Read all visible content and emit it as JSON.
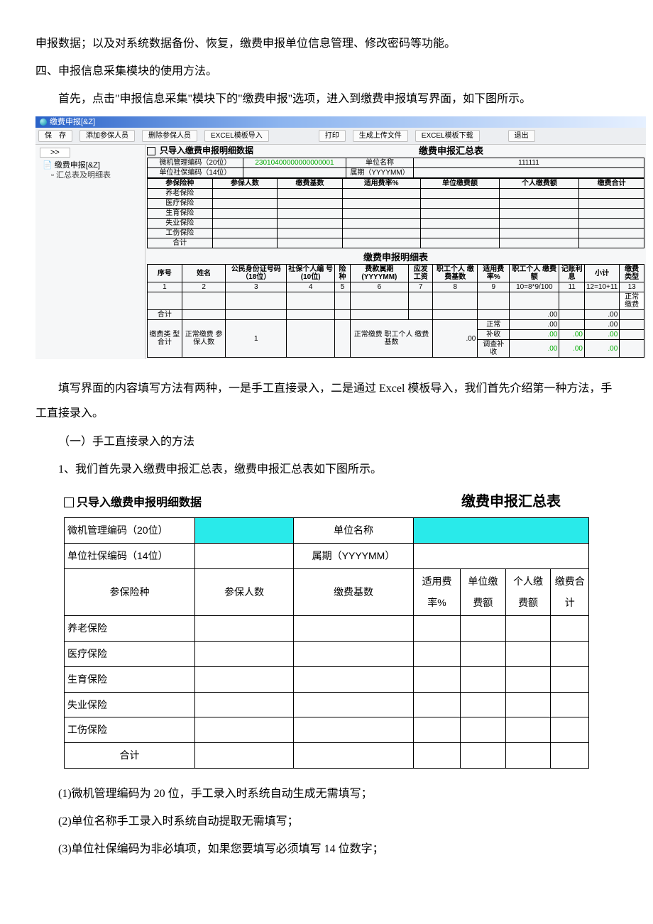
{
  "p": {
    "p1": "申报数据；以及对系统数据备份、恢复，缴费申报单位信息管理、修改密码等功能。",
    "p2": "四、申报信息采集模块的使用方法。",
    "p3": "首先，点击\"申报信息采集\"模块下的\"缴费申报\"选项，进入到缴费申报填写界面，如下图所示。",
    "p4": "填写界面的内容填写方法有两种，一是手工直接录入，二是通过 Excel 模板导入，我们首先介绍第一种方法，手工直接录入。",
    "p5": "（一）手工直接录入的方法",
    "p6": "1、我们首先录入缴费申报汇总表，缴费申报汇总表如下图所示。",
    "p7": "(1)微机管理编码为 20 位，手工录入时系统自动生成无需填写；",
    "p8": "(2)单位名称手工录入时系统自动提取无需填写；",
    "p9": "(3)单位社保编码为非必填项，如果您要填写必须填写 14 位数字；"
  },
  "s1": {
    "titlebar": "缴费申报[&Z]",
    "toolbar": [
      "保　存",
      "添加参保人员",
      "删除参保人员",
      "EXCEL模板导入",
      "打印",
      "生成上传文件",
      "EXCEL模板下载",
      "退出"
    ],
    "treeDD": ">>",
    "tree1": "缴费申报[&Z]",
    "tree2": "汇总表及明细表",
    "checkLabel": "只导入缴费申报明细数据",
    "sumTitle": "缴费申报汇总表",
    "sumInfo": {
      "code20": "微机管理编码（20位）",
      "code20v": "23010400000000000001",
      "unitName": "单位名称",
      "unitNameV": "111111",
      "code14": "单位社保编码（14位）",
      "belong": "属期（YYYYMM）"
    },
    "sumHeaders": [
      "参保险种",
      "参保人数",
      "缴费基数",
      "适用费率%",
      "单位缴费额",
      "个人缴费额",
      "缴费合计"
    ],
    "sumRows": [
      "养老保险",
      "医疗保险",
      "生育保险",
      "失业保险",
      "工伤保险",
      "合计"
    ],
    "detailTitle": "缴费申报明细表",
    "detailHeaders": [
      "序号",
      "姓名",
      "公民身份证号码\n（18位）",
      "社保个人编\n号(10位)",
      "险种",
      "费款属期\n(YYYYMM)",
      "应发工资",
      "职工个人\n缴费基数",
      "适用费\n率%",
      "职工个人\n缴费额",
      "记账利息",
      "小计",
      "缴费类型"
    ],
    "detailNumbers": [
      "1",
      "2",
      "3",
      "4",
      "5",
      "6",
      "7",
      "8",
      "9",
      "10=8*9/100",
      "11",
      "12=10+11",
      "13"
    ],
    "normalFee": "正常缴费",
    "sumBottom": {
      "heji": "合计",
      "leftA": "缴费类\n型合计",
      "leftB": "正常缴费\n参保人数",
      "oneVal": "1",
      "midA": "正常缴费\n职工个人\n缴费基数",
      "zero": ".00",
      "r1": "正常",
      "r2": "补收",
      "r3": "调查补收"
    }
  },
  "s2": {
    "checkLabel": "只导入缴费申报明细数据",
    "title": "缴费申报汇总表",
    "info": {
      "code20": "微机管理编码（20位）",
      "unitName": "单位名称",
      "code14": "单位社保编码（14位）",
      "belong": "属期（YYYYMM）"
    },
    "headers": [
      "参保险种",
      "参保人数",
      "缴费基数",
      "适用费率%",
      "单位缴费额",
      "个人缴费额",
      "缴费合计"
    ],
    "rows": [
      "养老保险",
      "医疗保险",
      "生育保险",
      "失业保险",
      "工伤保险",
      "合计"
    ]
  }
}
